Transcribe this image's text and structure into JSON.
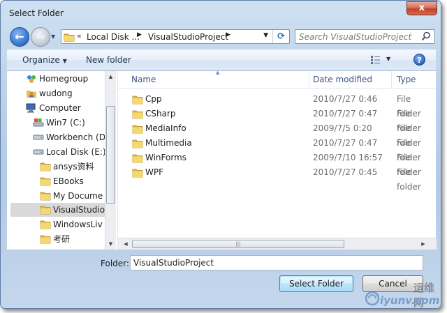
{
  "window": {
    "title": "Select Folder",
    "close_glyph": "x"
  },
  "navbar": {
    "back_icon": "back-arrow-icon",
    "forward_icon": "forward-arrow-icon",
    "address": {
      "overflow_glyph": "«",
      "crumbs": [
        "Local Disk ...",
        "VisualStudioProject"
      ],
      "separator_glyph": "▶",
      "dropdown_glyph": "▼",
      "refresh_glyph": "⟳"
    },
    "search": {
      "placeholder": "Search VisualStudioProject",
      "icon": "search-icon"
    }
  },
  "toolbar": {
    "organize_label": "Organize",
    "organize_arrow": "▼",
    "new_folder_label": "New folder",
    "view_arrow": "▼",
    "help_glyph": "?"
  },
  "nav_pane": {
    "items": [
      {
        "label": "Homegroup",
        "icon": "homegroup-icon"
      },
      {
        "label": "wudong",
        "icon": "user-folder-icon"
      },
      {
        "label": "Computer",
        "icon": "computer-icon"
      },
      {
        "label": "Win7 (C:)",
        "icon": "system-drive-icon"
      },
      {
        "label": "Workbench (D",
        "icon": "drive-icon"
      },
      {
        "label": "Local Disk (E:)",
        "icon": "drive-icon"
      },
      {
        "label": "ansys资料",
        "icon": "folder-icon"
      },
      {
        "label": "EBooks",
        "icon": "folder-icon"
      },
      {
        "label": "My Docume",
        "icon": "folder-icon"
      },
      {
        "label": "VisualStudio",
        "icon": "folder-icon",
        "selected": true
      },
      {
        "label": "WindowsLiv",
        "icon": "folder-icon"
      },
      {
        "label": "考研",
        "icon": "folder-icon"
      }
    ],
    "scroll_up_glyph": "▲",
    "scroll_down_glyph": "▼"
  },
  "file_list": {
    "columns": [
      "Name",
      "Date modified",
      "Type"
    ],
    "sort_glyph": "▲",
    "rows": [
      {
        "name": "Cpp",
        "date": "2010/7/27 0:46",
        "type": "File folder"
      },
      {
        "name": "CSharp",
        "date": "2010/7/27 0:47",
        "type": "File folder"
      },
      {
        "name": "MediaInfo",
        "date": "2009/7/5 0:20",
        "type": "File folder"
      },
      {
        "name": "Multimedia",
        "date": "2010/7/27 0:47",
        "type": "File folder"
      },
      {
        "name": "WinForms",
        "date": "2009/7/10 16:57",
        "type": "File folder"
      },
      {
        "name": "WPF",
        "date": "2010/7/27 0:45",
        "type": "File folder"
      }
    ],
    "hscroll_left_glyph": "◀",
    "hscroll_right_glyph": "▶",
    "hscroll_grip": "|||"
  },
  "footer": {
    "folder_label": "Folder:",
    "folder_value": "VisualStudioProject",
    "select_button": "Select Folder",
    "cancel_button": "Cancel"
  },
  "watermark": {
    "text_cn": "运维网",
    "text_en": "iyunv.com"
  }
}
